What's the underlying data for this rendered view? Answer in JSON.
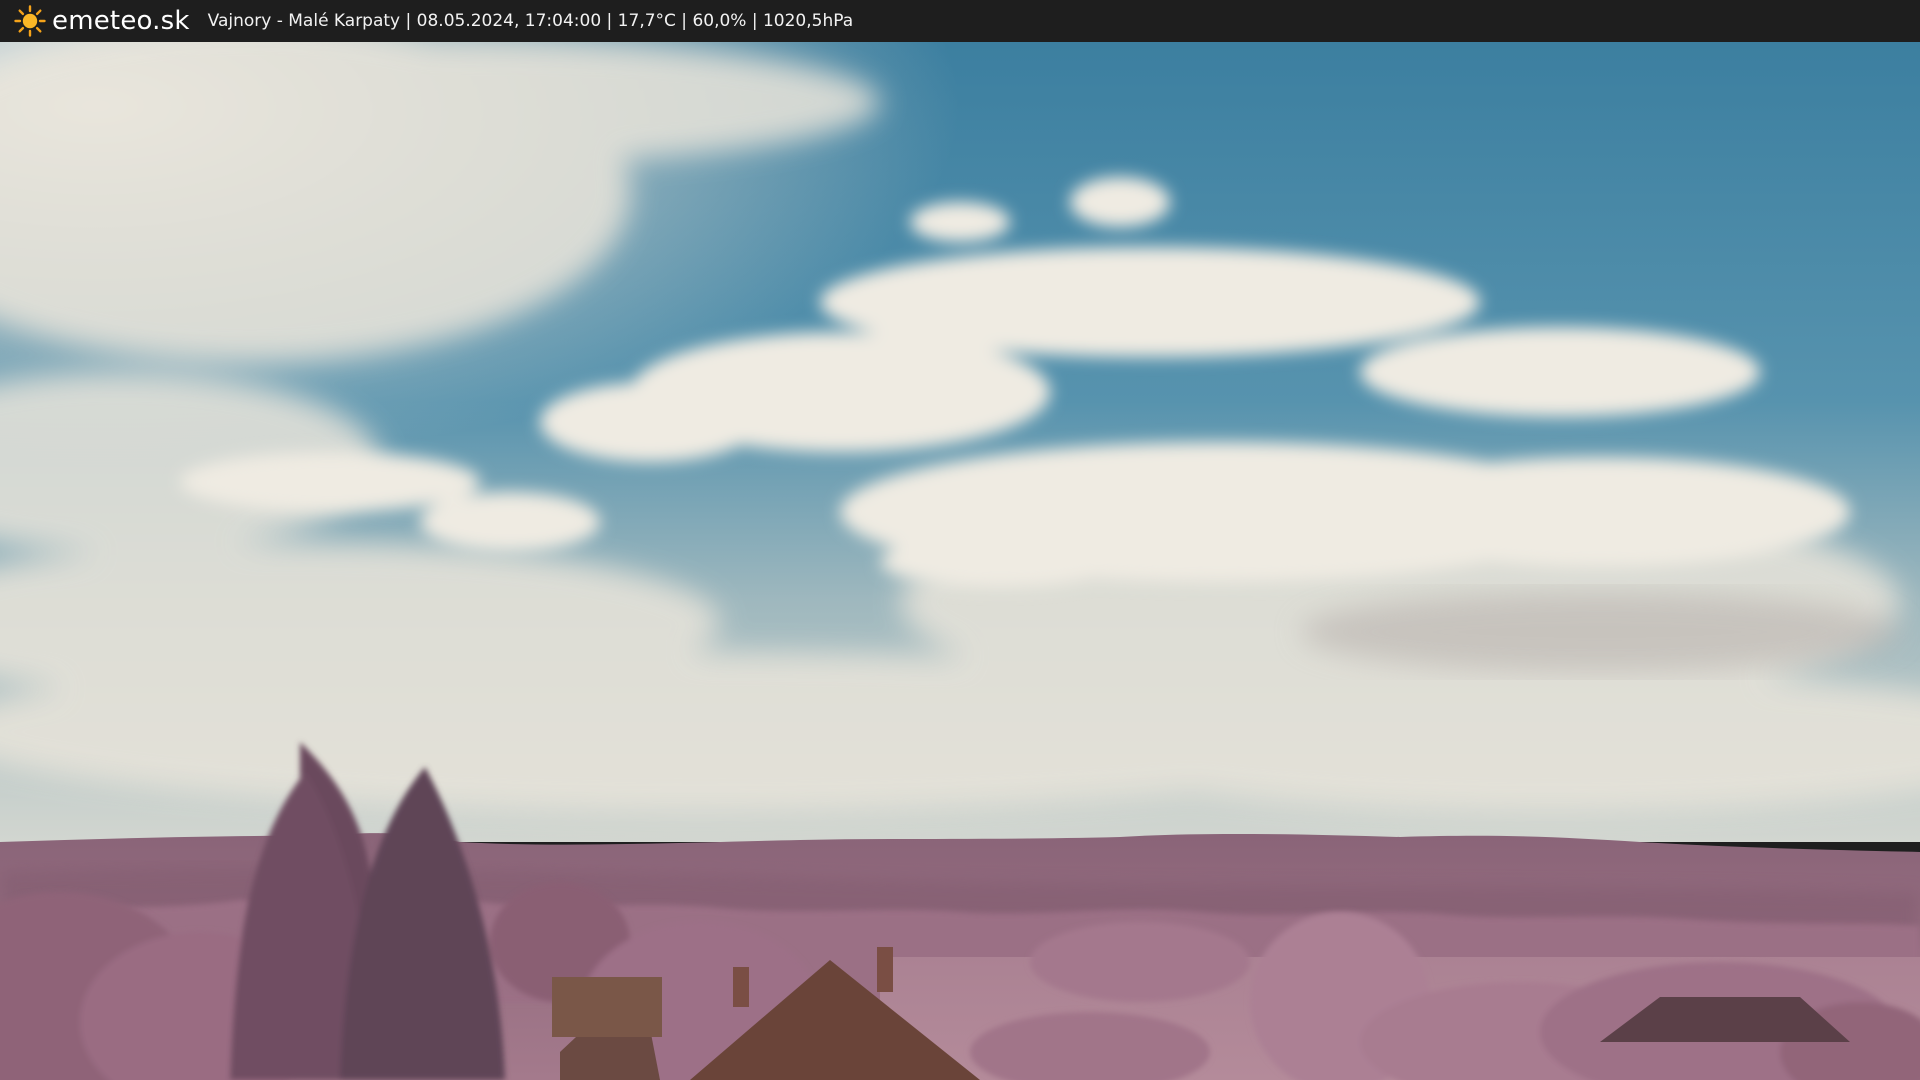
{
  "header": {
    "brand": "emeteo.sk",
    "caption": "Vajnory - Malé Karpaty | 08.05.2024, 17:04:00 | 17,7°C | 60,0% | 1020,5hPa",
    "logo_icon": "sun-icon",
    "bar_color": "#1e1e1e"
  },
  "scene": {
    "sky_colors": [
      "#3b7fa0",
      "#5e97b1",
      "#c9d2cf"
    ],
    "vegetation_color": "#a07088"
  }
}
